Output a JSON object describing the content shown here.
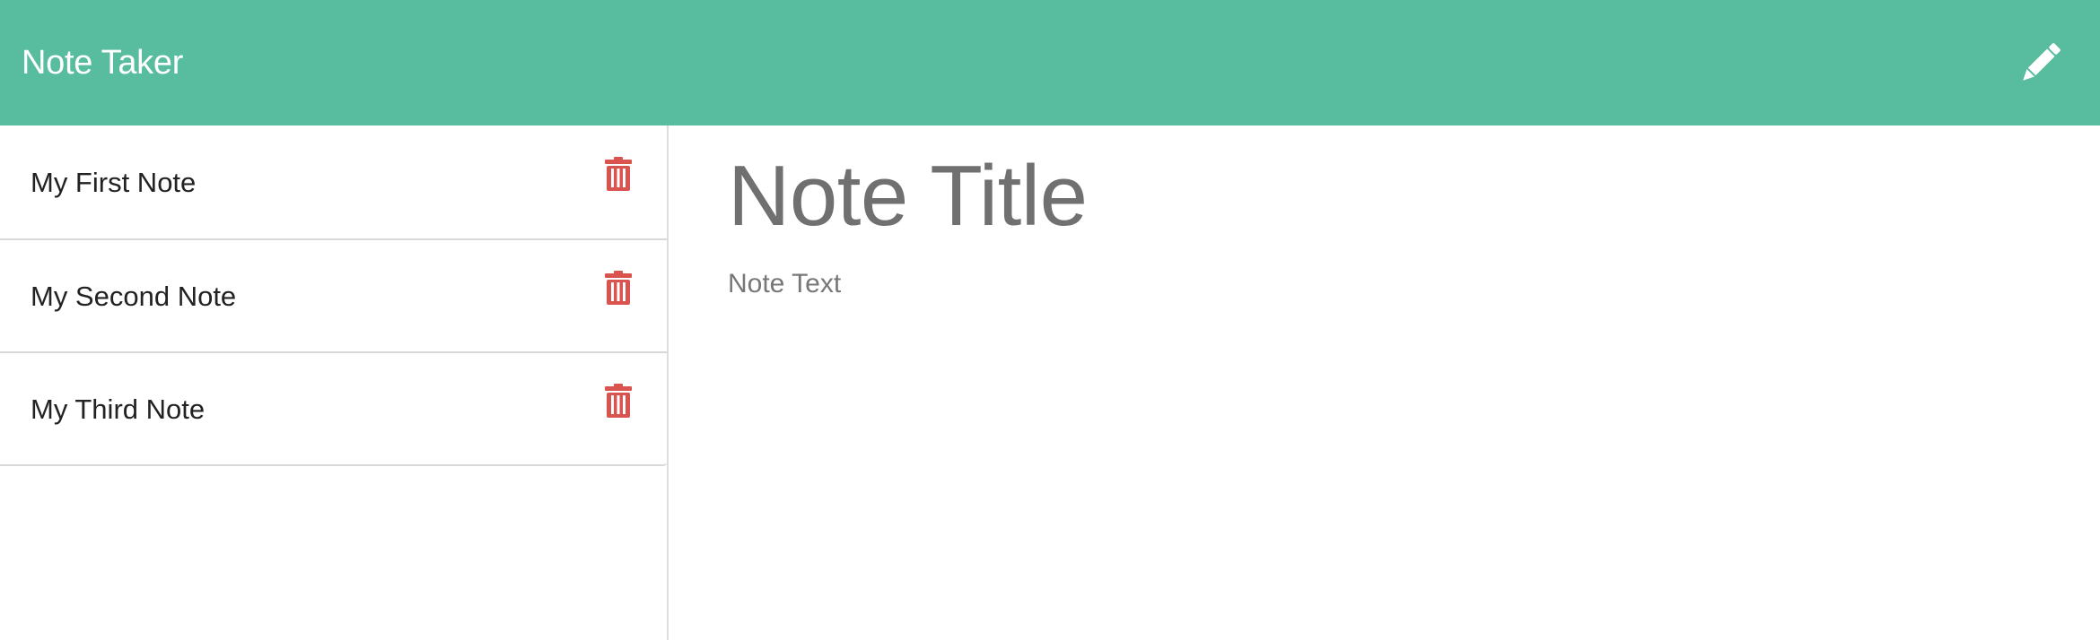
{
  "app": {
    "title": "Note Taker"
  },
  "navbar": {
    "brand": "Note Taker",
    "new_note_icon": "pencil-icon",
    "background_color": "#58bc9f"
  },
  "sidebar": {
    "notes": [
      {
        "title": "My First Note",
        "delete_icon": "trash-icon"
      },
      {
        "title": "My Second Note",
        "delete_icon": "trash-icon"
      },
      {
        "title": "My Third Note",
        "delete_icon": "trash-icon"
      }
    ],
    "delete_color": "#d9534f"
  },
  "editor": {
    "title_placeholder": "Note Title",
    "text_placeholder": "Note Text"
  }
}
